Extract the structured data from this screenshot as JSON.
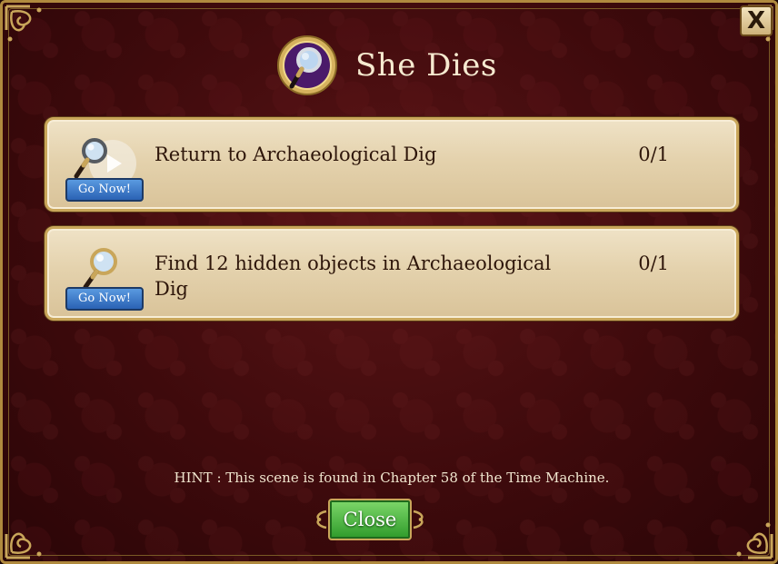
{
  "dialog": {
    "title": "She Dies",
    "title_icon": "magnifier-badge-icon",
    "close_x_label": "X"
  },
  "tasks": [
    {
      "description": "Return to Archaeological Dig",
      "progress": "0/1",
      "button_label": "Go Now!",
      "icon": "magnifier-play-icon"
    },
    {
      "description": "Find 12 hidden objects in Archaeological Dig",
      "progress": "0/1",
      "button_label": "Go Now!",
      "icon": "magnifier-icon"
    }
  ],
  "hint": "HINT : This scene is found in Chapter 58 of the Time Machine.",
  "footer": {
    "close_label": "Close"
  },
  "colors": {
    "background": "#3e0a0c",
    "gold_trim": "#c9a65a",
    "task_panel": "#e4d2ad",
    "go_button": "#2a62b4",
    "close_button": "#2e9a2a"
  }
}
